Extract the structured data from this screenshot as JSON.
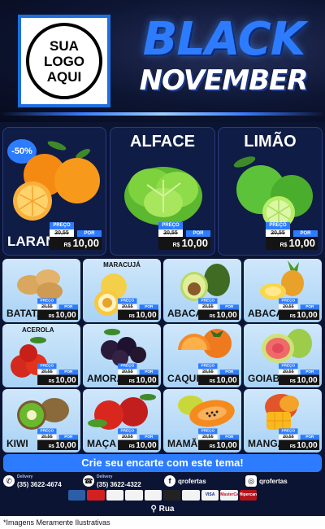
{
  "header": {
    "logo_lines": [
      "SUA",
      "LOGO",
      "AQUI"
    ],
    "title_line1": "BLACK",
    "title_line2": "NOVEMBER"
  },
  "price_labels": {
    "preco": "PREÇO",
    "por": "POR",
    "currency": "R$"
  },
  "featured": [
    {
      "name": "LARANJA",
      "badge": "-50%",
      "old_price": "20,55",
      "new_price": "10,00"
    },
    {
      "name": "ALFACE",
      "old_price": "20,55",
      "new_price": "10,00"
    },
    {
      "name": "LIMÃO",
      "old_price": "20,55",
      "new_price": "10,00"
    }
  ],
  "products": [
    {
      "name": "BATATA",
      "old_price": "20,55",
      "new_price": "10,00"
    },
    {
      "name": "MARACUJÁ",
      "old_price": "20,55",
      "new_price": "10,00"
    },
    {
      "name": "ABACATE",
      "old_price": "20,55",
      "new_price": "10,00"
    },
    {
      "name": "ABACAXI",
      "old_price": "20,55",
      "new_price": "10,00"
    },
    {
      "name": "ACEROLA",
      "old_price": "20,55",
      "new_price": "10,00"
    },
    {
      "name": "AMORA",
      "old_price": "20,55",
      "new_price": "10,00"
    },
    {
      "name": "CAQUI",
      "old_price": "20,55",
      "new_price": "10,00"
    },
    {
      "name": "GOIABA",
      "old_price": "20,55",
      "new_price": "10,00"
    },
    {
      "name": "KIWI",
      "old_price": "20,55",
      "new_price": "10,00"
    },
    {
      "name": "MAÇA",
      "old_price": "20,55",
      "new_price": "10,00"
    },
    {
      "name": "MAMÃO",
      "old_price": "20,55",
      "new_price": "10,00"
    },
    {
      "name": "MANGA",
      "old_price": "20,55",
      "new_price": "10,00"
    }
  ],
  "cta": "Crie seu encarte com este tema!",
  "contacts": [
    {
      "icon": "whatsapp-icon",
      "label": "Delivery",
      "value": "(35) 3622-4674"
    },
    {
      "icon": "phone-icon",
      "label": "Delivery",
      "value": "(35) 3622-4322"
    },
    {
      "icon": "facebook-icon",
      "value": "qrofertas"
    },
    {
      "icon": "instagram-icon",
      "value": "qrofertas"
    }
  ],
  "payments": [
    "",
    "",
    "",
    "",
    "",
    "",
    "",
    "VISA",
    "MasterCard",
    "Hipercard"
  ],
  "address": "Rua",
  "footer": "*Imagens Meramente Ilustrativas",
  "colors": {
    "accent": "#2d7cff",
    "background": "#0b1433",
    "cell": "#bfe0fa"
  }
}
